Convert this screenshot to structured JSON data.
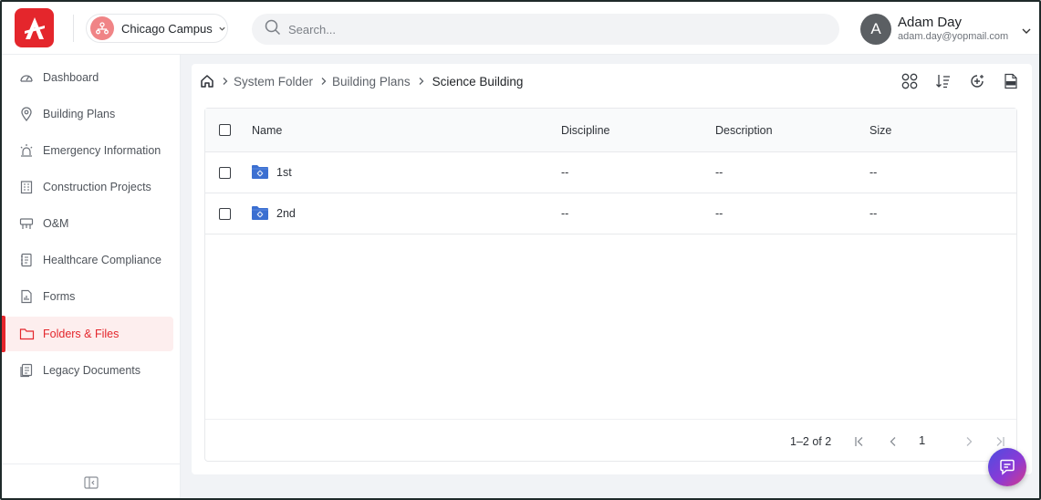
{
  "header": {
    "campus_label": "Chicago Campus",
    "search_placeholder": "Search...",
    "user": {
      "initial": "A",
      "name": "Adam Day",
      "email": "adam.day@yopmail.com"
    },
    "brand_color": "#e4262c"
  },
  "sidebar": {
    "items": [
      {
        "label": "Dashboard",
        "icon": "dashboard-gauge-icon"
      },
      {
        "label": "Building Plans",
        "icon": "map-pin-icon"
      },
      {
        "label": "Emergency Information",
        "icon": "siren-icon"
      },
      {
        "label": "Construction Projects",
        "icon": "building-icon"
      },
      {
        "label": "O&M",
        "icon": "projector-icon"
      },
      {
        "label": "Healthcare Compliance",
        "icon": "notebook-icon"
      },
      {
        "label": "Forms",
        "icon": "form-chart-icon"
      },
      {
        "label": "Folders & Files",
        "icon": "folder-icon",
        "active": true
      },
      {
        "label": "Legacy Documents",
        "icon": "documents-icon"
      }
    ],
    "collapse_icon": "collapse-sidebar-icon"
  },
  "breadcrumb": {
    "home_icon": "home-icon",
    "items": [
      "System Folder",
      "Building Plans"
    ],
    "current": "Science Building"
  },
  "toolbar": {
    "icons": [
      "grid-view-icon",
      "sort-icon",
      "add-icon",
      "export-xls-icon"
    ]
  },
  "table": {
    "columns": [
      "Name",
      "Discipline",
      "Description",
      "Size"
    ],
    "rows": [
      {
        "name": "1st",
        "discipline": "--",
        "description": "--",
        "size": "--"
      },
      {
        "name": "2nd",
        "discipline": "--",
        "description": "--",
        "size": "--"
      }
    ]
  },
  "pagination": {
    "range": "1–2 of 2",
    "current_page": "1"
  }
}
